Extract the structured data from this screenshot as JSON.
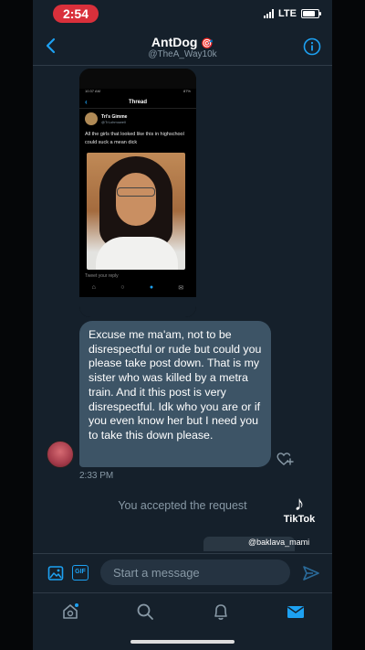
{
  "status_bar": {
    "time": "2:54",
    "carrier": "LTE",
    "signal_bars": 4,
    "battery_level": 0.8
  },
  "header": {
    "title": "AntDog",
    "title_emoji": "🎯",
    "handle": "@TheA_Way10k"
  },
  "media_screenshot": {
    "screen_title": "Thread",
    "status_time": "10:37 AM",
    "status_battery": "87%",
    "tweet_author": "Tri's Gimme",
    "tweet_handle": "@TrLohmowell",
    "tweet_text": "All the girls that looked like this in highschool could suck a mean dick",
    "reply_placeholder": "Tweet your reply"
  },
  "message": {
    "text": "Excuse me ma'am, not to be disrespectful or rude but could you please take post down. That is my sister who was killed by a metra train. And it this post is very disrespectful. Idk who you are or if you even know her but I need you to take this down please.",
    "timestamp": "2:33 PM"
  },
  "system_note": "You accepted the request",
  "watermark": {
    "brand": "TikTok",
    "user": "@baklava_mami"
  },
  "composer": {
    "gif_label": "GIF",
    "placeholder": "Start a message"
  },
  "colors": {
    "background": "#15202b",
    "bubble": "#3d5466",
    "accent": "#1da1f2",
    "clock_pill": "#d9303b",
    "muted": "#8899a6"
  },
  "icons": [
    "back-chevron-icon",
    "info-icon",
    "heart-plus-icon",
    "image-icon",
    "gif-icon",
    "send-icon",
    "home-icon",
    "search-icon",
    "bell-icon",
    "mail-icon"
  ]
}
